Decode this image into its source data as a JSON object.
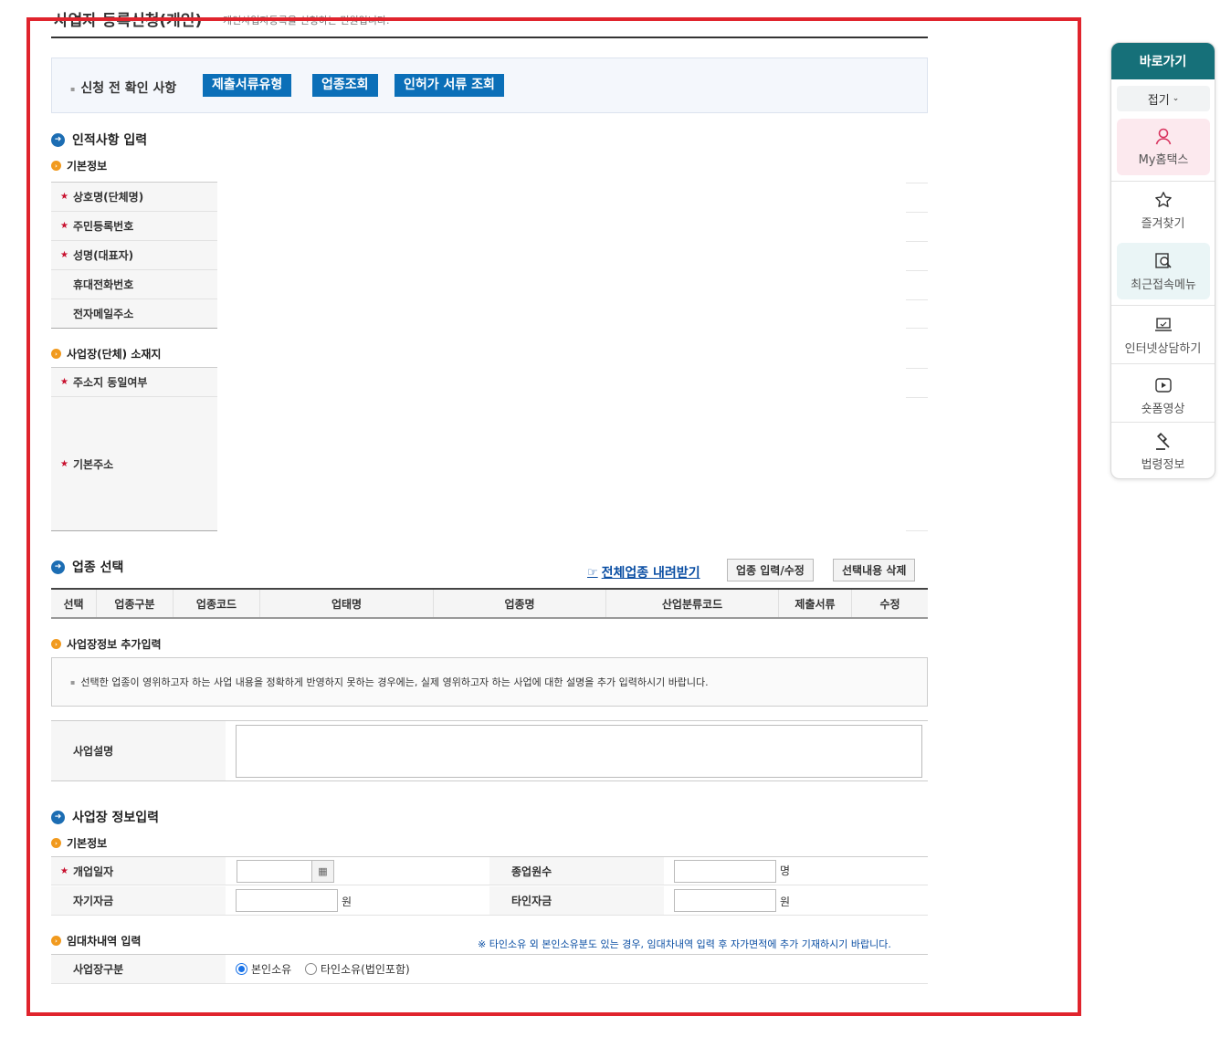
{
  "page": {
    "title": "사업자 등록신청(개인)",
    "description": "개인사업자등록을 신청하는 민원입니다."
  },
  "pre_check": {
    "label": "신청 전 확인 사항",
    "buttons": [
      "제출서류유형",
      "업종조회",
      "인허가 서류 조회"
    ]
  },
  "personal": {
    "title": "인적사항 입력",
    "basic_title": "기본정보",
    "fields": [
      {
        "label": "상호명(단체명)",
        "required": true
      },
      {
        "label": "주민등록번호",
        "required": true
      },
      {
        "label": "성명(대표자)",
        "required": true
      },
      {
        "label": "휴대전화번호",
        "required": false
      },
      {
        "label": "전자메일주소",
        "required": false
      }
    ],
    "location_title": "사업장(단체) 소재지",
    "location_fields": [
      {
        "label": "주소지 동일여부",
        "required": true
      },
      {
        "label": "기본주소",
        "required": true
      }
    ]
  },
  "business_type": {
    "title": "업종 선택",
    "download_link": "전체업종 내려받기",
    "buttons": [
      "업종 입력/수정",
      "선택내용 삭제"
    ],
    "columns": [
      "선택",
      "업종구분",
      "업종코드",
      "업태명",
      "업종명",
      "산업분류코드",
      "제출서류",
      "수정"
    ],
    "extra_title": "사업장정보 추가입력",
    "notice": "선택한 업종이 영위하고자 하는 사업 내용을 정확하게 반영하지 못하는 경우에는, 실제 영위하고자 하는 사업에 대한 설명을 추가 입력하시기 바랍니다.",
    "description_label": "사업설명",
    "description_value": ""
  },
  "site_info": {
    "title": "사업장 정보입력",
    "basic_title": "기본정보",
    "open_date_label": "개업일자",
    "employees_label": "종업원수",
    "employees_unit": "명",
    "own_capital_label": "자기자금",
    "own_capital_unit": "원",
    "other_capital_label": "타인자금",
    "other_capital_unit": "원",
    "open_date_value": "",
    "employees_value": "",
    "own_capital_value": "",
    "other_capital_value": ""
  },
  "lease": {
    "title": "임대차내역 입력",
    "note": "※ 타인소유 외 본인소유분도 있는 경우, 임대차내역 입력 후 자가면적에 추가 기재하시기 바랍니다.",
    "type_label": "사업장구분",
    "options": [
      "본인소유",
      "타인소유(법인포함)"
    ],
    "selected": "본인소유"
  },
  "quick_menu": {
    "title": "바로가기",
    "fold": "접기",
    "items": [
      "My홈택스",
      "즐겨찾기",
      "최근접속메뉴",
      "인터넷상담하기",
      "숏폼영상",
      "법령정보"
    ]
  },
  "colors": {
    "accent_blue": "#0b6fb8",
    "frame_red": "#e0242d",
    "quick_teal": "#167079",
    "required_red": "#c8102e",
    "section_orange": "#f19a1e"
  }
}
